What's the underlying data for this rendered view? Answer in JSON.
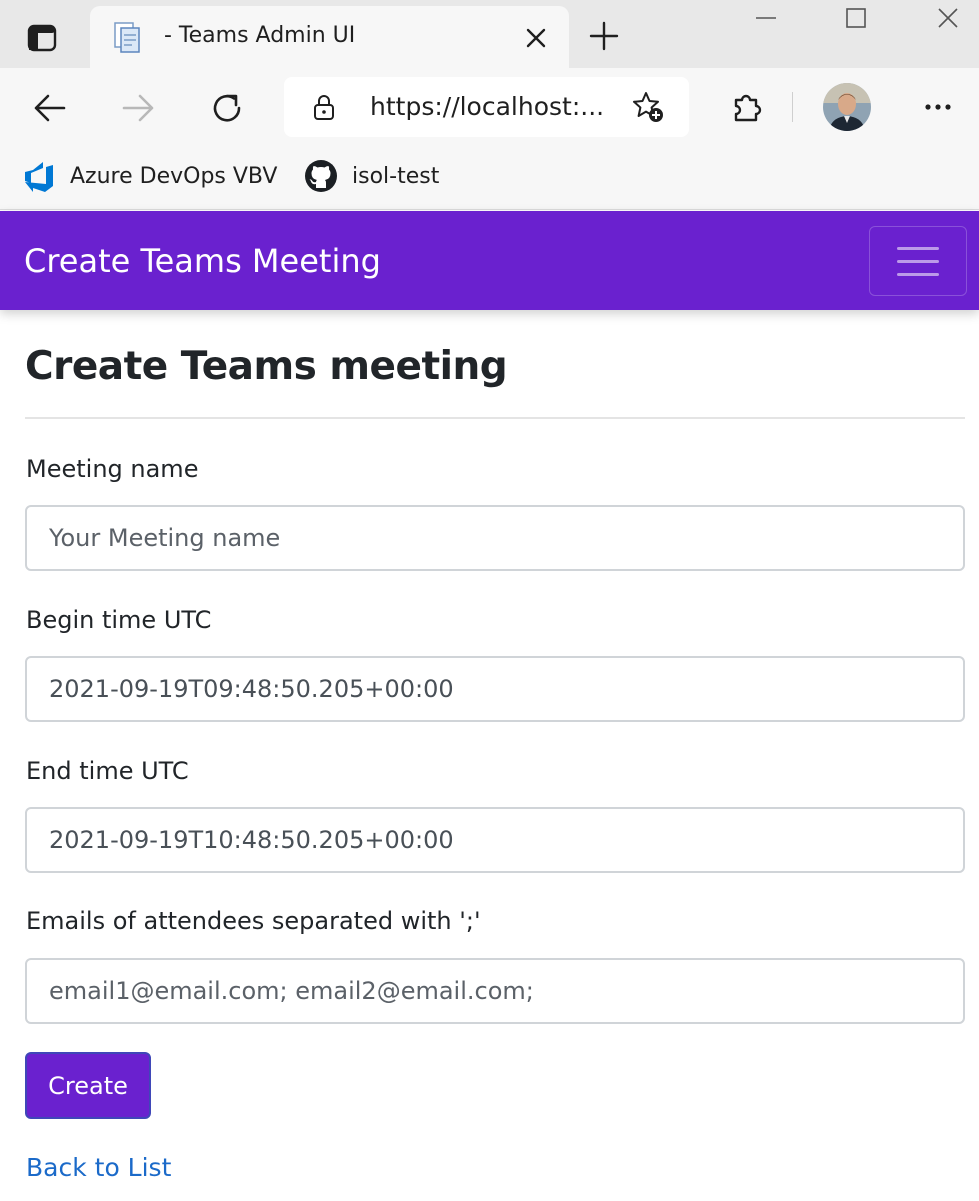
{
  "browser": {
    "tab": {
      "title": "- Teams Admin UI"
    },
    "address_bar": {
      "url": "https://localhost:..."
    },
    "bookmarks": [
      {
        "label": "Azure DevOps VBV",
        "icon": "azure-devops-icon"
      },
      {
        "label": "isol-test",
        "icon": "github-icon"
      }
    ],
    "colors": {
      "chrome_bg": "#e8e8e8",
      "toolbar_bg": "#f7f7f7"
    }
  },
  "app": {
    "navbar": {
      "brand": "Create Teams Meeting",
      "color": "#6a21cf"
    },
    "page_title": "Create Teams meeting",
    "form": {
      "meeting_name": {
        "label": "Meeting name",
        "value": "",
        "placeholder": "Your Meeting name"
      },
      "begin_time": {
        "label": "Begin time UTC",
        "value": "2021-09-19T09:48:50.205+00:00",
        "placeholder": ""
      },
      "end_time": {
        "label": "End time UTC",
        "value": "2021-09-19T10:48:50.205+00:00",
        "placeholder": ""
      },
      "emails": {
        "label": "Emails of attendees separated with ';'",
        "value": "",
        "placeholder": "email1@email.com; email2@email.com;"
      },
      "submit_label": "Create"
    },
    "back_link": "Back to List",
    "colors": {
      "primary": "#6a21cf",
      "link": "#1b6ac9"
    }
  }
}
